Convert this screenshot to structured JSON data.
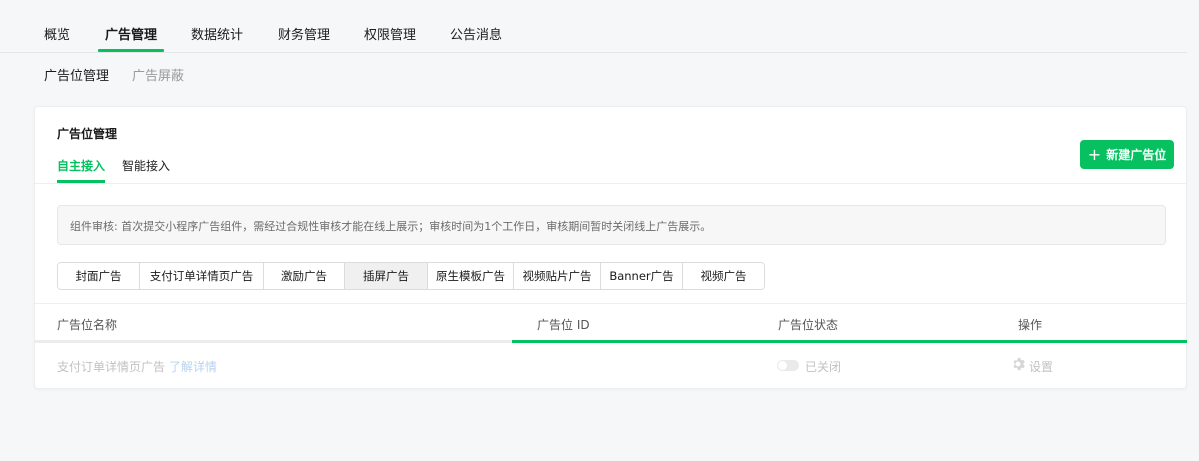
{
  "top_nav": {
    "tabs": [
      "概览",
      "广告管理",
      "数据统计",
      "财务管理",
      "权限管理",
      "公告消息"
    ],
    "active_index": 1
  },
  "sub_nav": {
    "items": [
      "广告位管理",
      "广告屏蔽"
    ],
    "active_index": 0
  },
  "card": {
    "title": "广告位管理",
    "tabs": [
      "自主接入",
      "智能接入"
    ],
    "active_tab": 0,
    "new_button_label": "新建广告位",
    "notice": "组件审核: 首次提交小程序广告组件，需经过合规性审核才能在线上展示；审核时间为1个工作日，审核期间暂时关闭线上广告展示。",
    "ad_types": [
      "封面广告",
      "支付订单详情页广告",
      "激励广告",
      "插屏广告",
      "原生模板广告",
      "视频贴片广告",
      "Banner广告",
      "视频广告"
    ],
    "active_ad_type": 3,
    "table": {
      "columns": [
        "广告位名称",
        "广告位 ID",
        "广告位状态",
        "操作"
      ],
      "rows": [
        {
          "name": "支付订单详情页广告",
          "link": "了解详情",
          "id": "",
          "status": "已关闭",
          "action": "设置"
        }
      ]
    }
  },
  "colors": {
    "accent": "#07c160",
    "background": "#f6f7f9"
  }
}
